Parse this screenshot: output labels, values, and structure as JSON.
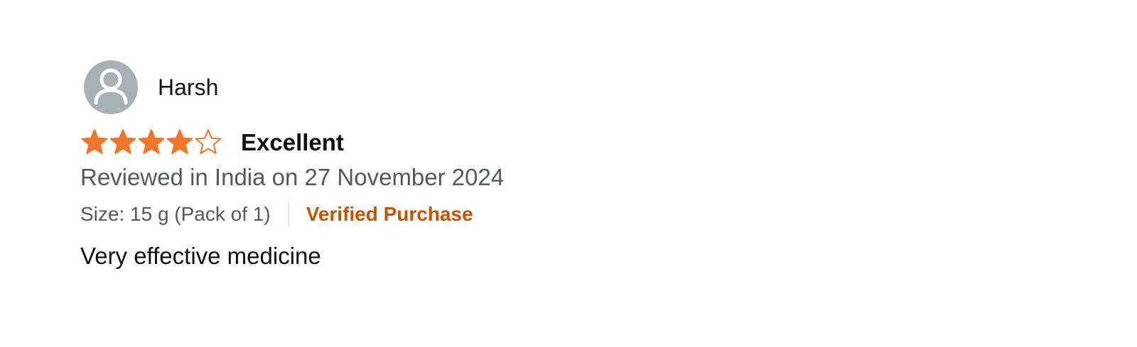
{
  "review": {
    "reviewer_name": "Harsh",
    "avatar_icon": "default-user-avatar-icon",
    "rating": 4,
    "rating_max": 5,
    "star_color": "#f0762c",
    "title": "Excellent",
    "date_text": "Reviewed in India on 27 November 2024",
    "variant": "Size: 15 g (Pack of 1)",
    "badge": "Verified Purchase",
    "badge_color": "#c45500",
    "body": "Very effective medicine"
  }
}
